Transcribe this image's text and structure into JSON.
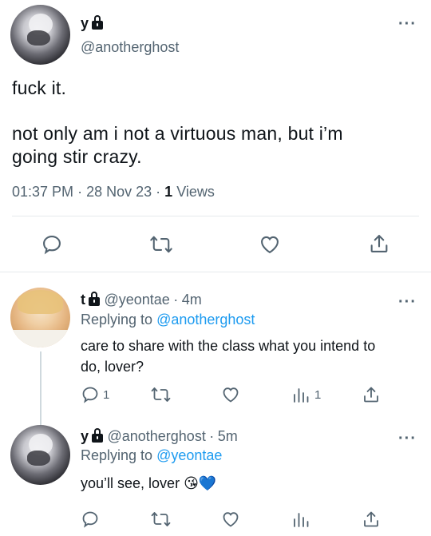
{
  "main_tweet": {
    "name": "y",
    "handle": "@anotherghost",
    "text_line1": "fuck it.",
    "text_line2": "not only am i not a virtuous man, but i’m",
    "text_line3": "going stir crazy.",
    "time": "01:37 PM",
    "sep1": "·",
    "date": "28 Nov 23",
    "sep2": "·",
    "views_count": "1",
    "views_label": "Views"
  },
  "reply1": {
    "name": "t",
    "handle": "@yeontae",
    "sep": "·",
    "time": "4m",
    "replying_prefix": "Replying to",
    "replying_to": "@anotherghost",
    "text_line1": "care to share with the class what you intend to",
    "text_line2": "do, lover?",
    "reply_count": "1",
    "views_count": "1"
  },
  "reply2": {
    "name": "y",
    "handle": "@anotherghost",
    "sep": "·",
    "time": "5m",
    "replying_prefix": "Replying to",
    "replying_to": "@yeontae",
    "text": "you’ll see, lover",
    "emoji1": "😘",
    "emoji2": "💙"
  },
  "colors": {
    "accent_link": "#1d9bf0",
    "secondary_text": "#536471",
    "primary_text": "#0f1419",
    "divider": "#e6e9ec"
  },
  "icons": [
    "reply-icon",
    "retweet-icon",
    "like-icon",
    "share-icon",
    "views-icon",
    "more-icon",
    "lock-icon"
  ]
}
